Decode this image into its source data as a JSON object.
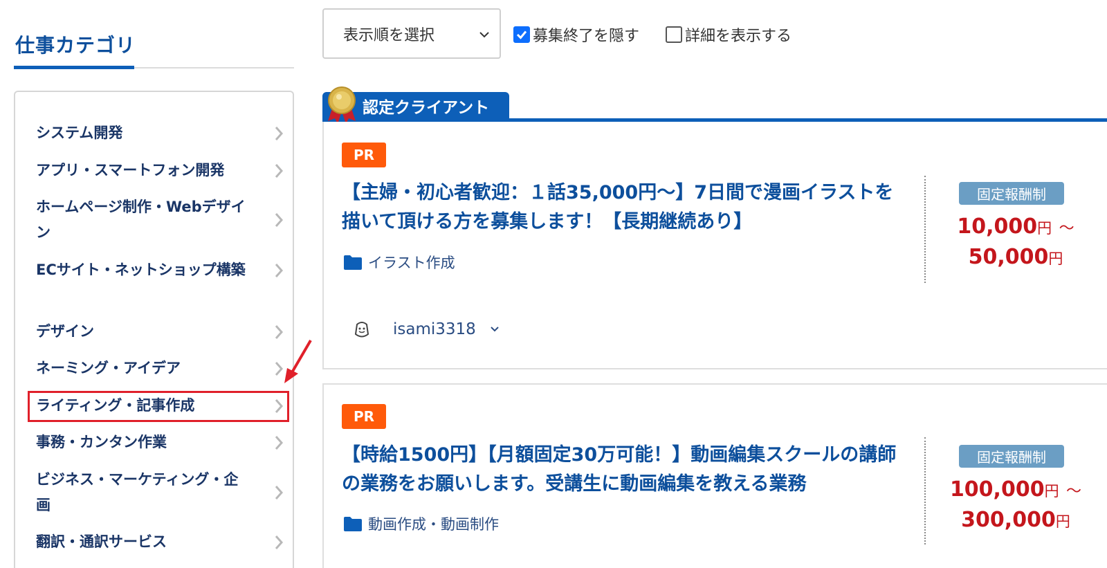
{
  "sidebar": {
    "heading": "仕事カテゴリ",
    "items": [
      {
        "label": "システム開発"
      },
      {
        "label": "アプリ・スマートフォン開発"
      },
      {
        "label": "ホームページ制作・Webデザイン"
      },
      {
        "label": "ECサイト・ネットショップ構築"
      },
      {
        "label": "デザイン"
      },
      {
        "label": "ネーミング・アイデア"
      },
      {
        "label": "ライティング・記事作成"
      },
      {
        "label": "事務・カンタン作業"
      },
      {
        "label": "ビジネス・マーケティング・企画"
      },
      {
        "label": "翻訳・通訳サービス"
      }
    ],
    "highlighted_index": 6
  },
  "controls": {
    "sort_label": "表示順を選択",
    "hide_closed_label": "募集終了を隠す",
    "hide_closed_checked": true,
    "show_details_label": "詳細を表示する",
    "show_details_checked": false
  },
  "certified": {
    "label": "認定クライアント"
  },
  "jobs": [
    {
      "badge": "PR",
      "title": "【主婦・初心者歓迎：１話35,000円〜】7日間で漫画イラストを描いて頂ける方を募集します！【長期継続あり】",
      "category": "イラスト作成",
      "pay_type": "固定報酬制",
      "price_min": "10,000",
      "price_max": "50,000",
      "yen": "円",
      "tilde": "〜",
      "user": "isami3318"
    },
    {
      "badge": "PR",
      "title": "【時給1500円】【月額固定30万可能！】動画編集スクールの講師の業務をお願いします。受講生に動画編集を教える業務",
      "category": "動画作成・動画制作",
      "pay_type": "固定報酬制",
      "price_min": "100,000",
      "price_max": "300,000",
      "yen": "円",
      "tilde": "〜"
    }
  ],
  "colors": {
    "brand_blue": "#0d5fb8",
    "price_red": "#c4161c",
    "pr_orange": "#ff5a0a",
    "pay_type_blue": "#6b9ec4",
    "highlight_red": "#e0202a"
  },
  "icons": {
    "chevron": "chevron-right-icon",
    "folder": "folder-icon",
    "medal": "medal-icon",
    "avatar": "user-avatar-icon",
    "arrow": "red-arrow-annotation"
  }
}
